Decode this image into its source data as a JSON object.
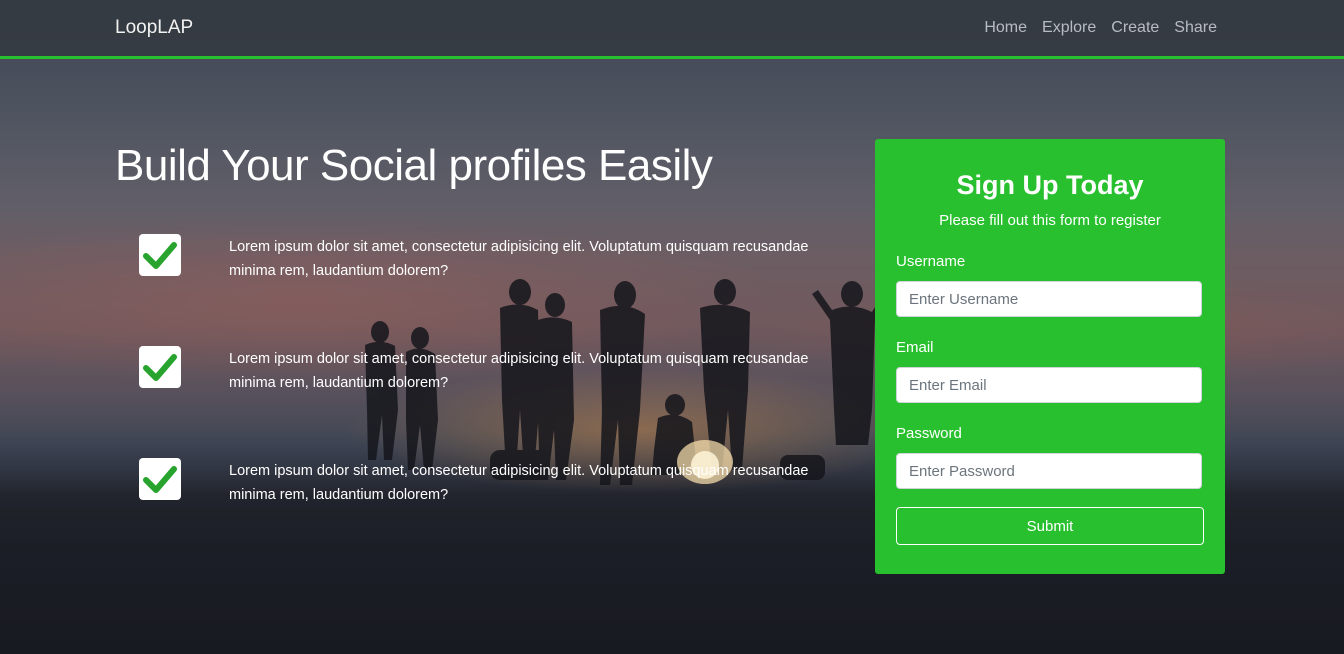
{
  "navbar": {
    "brand": "LoopLAP",
    "links": [
      "Home",
      "Explore",
      "Create",
      "Share"
    ],
    "accent_color": "#28c02e"
  },
  "hero": {
    "title_part1": "Build Your ",
    "title_part2": "Social profiles",
    "title_part3": " Easily",
    "features": [
      {
        "icon": "check-icon",
        "text": "Lorem ipsum dolor sit amet, consectetur adipisicing elit. Voluptatum quisquam recusandae minima rem, laudantium dolorem?"
      },
      {
        "icon": "check-icon",
        "text": "Lorem ipsum dolor sit amet, consectetur adipisicing elit. Voluptatum quisquam recusandae minima rem, laudantium dolorem?"
      },
      {
        "icon": "check-icon",
        "text": "Lorem ipsum dolor sit amet, consectetur adipisicing elit. Voluptatum quisquam recusandae minima rem, laudantium dolorem?"
      }
    ]
  },
  "signup": {
    "title": "Sign Up Today",
    "subtitle": "Please fill out this form to register",
    "background_color": "#28c02e",
    "fields": [
      {
        "label": "Username",
        "placeholder": "Enter Username",
        "value": ""
      },
      {
        "label": "Email",
        "placeholder": "Enter Email",
        "value": ""
      },
      {
        "label": "Password",
        "placeholder": "Enter Password",
        "value": ""
      }
    ],
    "submit_label": "Submit"
  }
}
